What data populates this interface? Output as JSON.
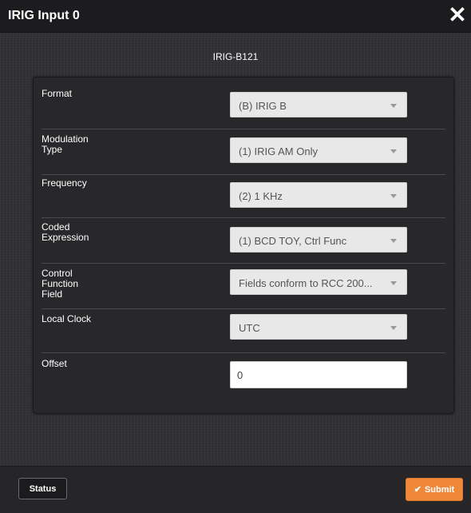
{
  "dialog": {
    "title": "IRIG Input 0",
    "close_glyph": "✕",
    "subtitle": "IRIG-B121"
  },
  "fields": [
    {
      "label": "Format",
      "value": "(B) IRIG B",
      "type": "select"
    },
    {
      "label": "Modulation\nType",
      "value": "(1) IRIG AM Only",
      "type": "select"
    },
    {
      "label": "Frequency",
      "value": "(2) 1 KHz",
      "type": "select"
    },
    {
      "label": "Coded\nExpression",
      "value": "(1) BCD TOY, Ctrl Func",
      "type": "select"
    },
    {
      "label": "Control\nFunction\nField",
      "value": "Fields conform to RCC 200...",
      "type": "select"
    },
    {
      "label": "Local Clock",
      "value": "UTC",
      "type": "select"
    },
    {
      "label": "Offset",
      "value": "0",
      "type": "input"
    }
  ],
  "footer": {
    "status_label": "Status",
    "submit_label": "Submit",
    "submit_icon": "check-icon"
  },
  "colors": {
    "accent": "#f0883a",
    "titlebar": "#1c1c1e",
    "panel": "#28282b"
  }
}
